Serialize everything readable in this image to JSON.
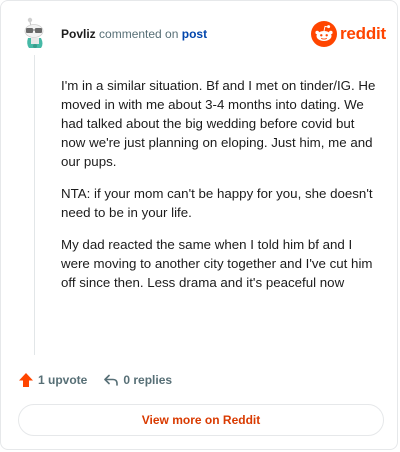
{
  "header": {
    "username": "Povliz",
    "action_text": "commented on",
    "post_link": "post"
  },
  "brand": {
    "wordmark": "reddit",
    "color": "#ff4500"
  },
  "comment": {
    "paragraphs": [
      "I'm in a similar situation. Bf and I met on tinder/IG. He moved in with me about 3-4 months into dating. We had talked about the big wedding before covid but now we're just planning on eloping. Just him, me and our pups.",
      "NTA: if your mom can't be happy for you, she doesn't need to be in your life.",
      "My dad reacted the same when I told him bf and I were moving to another city together and I've cut him off since then. Less drama and it's peaceful now"
    ]
  },
  "actions": {
    "upvote_label": "1 upvote",
    "upvote_icon": "upvote-arrow-icon",
    "upvote_color": "#ff4500",
    "replies_label": "0 replies",
    "replies_icon": "reply-arrow-icon"
  },
  "footer": {
    "view_more_label": "View more on Reddit",
    "view_more_color": "#d93a00"
  }
}
